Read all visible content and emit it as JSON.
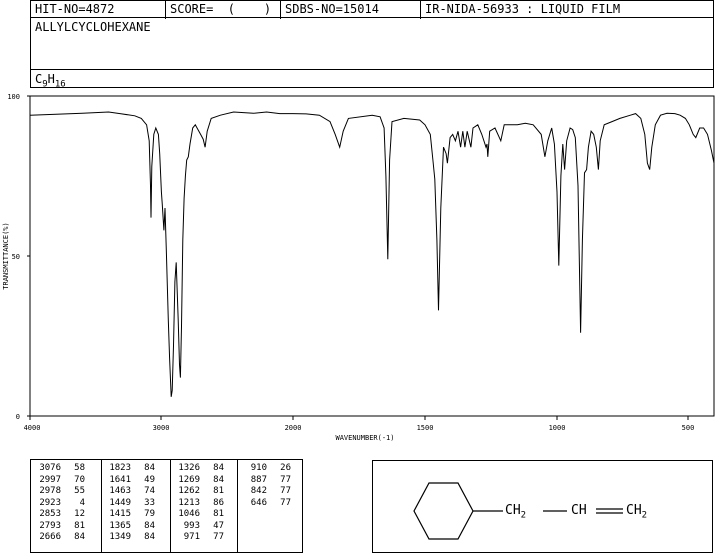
{
  "header": {
    "hit_no": "HIT-NO=4872",
    "score": "SCORE=  (    )",
    "sdbs_no": "SDBS-NO=15014",
    "method": "IR-NIDA-56933 : LIQUID FILM"
  },
  "compound": {
    "name": "ALLYLCYCLOHEXANE",
    "formula_c": "C",
    "formula_c_sub": "9",
    "formula_h": "H",
    "formula_h_sub": "16"
  },
  "chart_data": {
    "type": "line",
    "xlabel": "WAVENUMBER(-1)",
    "ylabel": "TRANSMITTANCE(%)",
    "xlim": [
      4000,
      400
    ],
    "ylim": [
      0,
      100
    ],
    "x_ticks": [
      4000,
      3000,
      2000,
      1500,
      1000,
      500
    ],
    "y_ticks": [
      100,
      50,
      0
    ],
    "x_tick_labels": [
      "4000",
      "3000",
      "2000",
      "1500",
      "1000",
      "500"
    ],
    "y_tick_labels": [
      "100",
      "50",
      "0"
    ],
    "series": [
      {
        "points": [
          [
            4000,
            94
          ],
          [
            3800,
            94.3
          ],
          [
            3600,
            94.6
          ],
          [
            3400,
            95
          ],
          [
            3300,
            94.4
          ],
          [
            3200,
            93.8
          ],
          [
            3150,
            93
          ],
          [
            3110,
            91
          ],
          [
            3090,
            86
          ],
          [
            3080,
            72
          ],
          [
            3076,
            62
          ],
          [
            3070,
            78
          ],
          [
            3055,
            88
          ],
          [
            3040,
            90
          ],
          [
            3020,
            88
          ],
          [
            3010,
            82
          ],
          [
            2997,
            70
          ],
          [
            2990,
            66
          ],
          [
            2978,
            58
          ],
          [
            2970,
            65
          ],
          [
            2960,
            52
          ],
          [
            2945,
            30
          ],
          [
            2935,
            18
          ],
          [
            2923,
            6
          ],
          [
            2915,
            8
          ],
          [
            2905,
            22
          ],
          [
            2895,
            42
          ],
          [
            2885,
            48
          ],
          [
            2870,
            30
          ],
          [
            2860,
            16
          ],
          [
            2853,
            12
          ],
          [
            2845,
            28
          ],
          [
            2835,
            55
          ],
          [
            2825,
            68
          ],
          [
            2815,
            75
          ],
          [
            2805,
            80
          ],
          [
            2793,
            81
          ],
          [
            2780,
            85
          ],
          [
            2760,
            90
          ],
          [
            2740,
            91
          ],
          [
            2700,
            88
          ],
          [
            2680,
            86.5
          ],
          [
            2666,
            84
          ],
          [
            2650,
            89
          ],
          [
            2620,
            93
          ],
          [
            2550,
            94
          ],
          [
            2450,
            95
          ],
          [
            2300,
            94.6
          ],
          [
            2200,
            95
          ],
          [
            2100,
            94.5
          ],
          [
            2000,
            94.5
          ],
          [
            1950,
            94.4
          ],
          [
            1900,
            94
          ],
          [
            1860,
            92
          ],
          [
            1840,
            88
          ],
          [
            1823,
            84
          ],
          [
            1810,
            89
          ],
          [
            1790,
            93
          ],
          [
            1700,
            94
          ],
          [
            1670,
            93.5
          ],
          [
            1655,
            90
          ],
          [
            1648,
            75
          ],
          [
            1641,
            49
          ],
          [
            1634,
            80
          ],
          [
            1625,
            92
          ],
          [
            1580,
            93
          ],
          [
            1520,
            92.5
          ],
          [
            1500,
            91
          ],
          [
            1480,
            88
          ],
          [
            1470,
            80
          ],
          [
            1463,
            74
          ],
          [
            1455,
            55
          ],
          [
            1449,
            33
          ],
          [
            1440,
            65
          ],
          [
            1430,
            84
          ],
          [
            1420,
            82
          ],
          [
            1415,
            79
          ],
          [
            1405,
            87
          ],
          [
            1395,
            88
          ],
          [
            1385,
            86
          ],
          [
            1375,
            89
          ],
          [
            1365,
            84
          ],
          [
            1357,
            89
          ],
          [
            1349,
            84
          ],
          [
            1340,
            89
          ],
          [
            1326,
            84
          ],
          [
            1318,
            90
          ],
          [
            1300,
            91
          ],
          [
            1285,
            88
          ],
          [
            1269,
            84
          ],
          [
            1265,
            85
          ],
          [
            1262,
            81
          ],
          [
            1255,
            89
          ],
          [
            1235,
            90
          ],
          [
            1213,
            86
          ],
          [
            1200,
            91
          ],
          [
            1150,
            91
          ],
          [
            1120,
            91.5
          ],
          [
            1090,
            91
          ],
          [
            1060,
            88
          ],
          [
            1046,
            81
          ],
          [
            1035,
            86
          ],
          [
            1020,
            90
          ],
          [
            1010,
            85
          ],
          [
            1000,
            70
          ],
          [
            993,
            47
          ],
          [
            985,
            75
          ],
          [
            978,
            85
          ],
          [
            971,
            77
          ],
          [
            963,
            86
          ],
          [
            950,
            90
          ],
          [
            940,
            89.5
          ],
          [
            930,
            87
          ],
          [
            920,
            72
          ],
          [
            910,
            26
          ],
          [
            903,
            55
          ],
          [
            895,
            76
          ],
          [
            887,
            77
          ],
          [
            880,
            84
          ],
          [
            870,
            89
          ],
          [
            860,
            88
          ],
          [
            850,
            84
          ],
          [
            842,
            77
          ],
          [
            835,
            86
          ],
          [
            820,
            91
          ],
          [
            790,
            92
          ],
          [
            760,
            93
          ],
          [
            720,
            94
          ],
          [
            700,
            94.5
          ],
          [
            680,
            93
          ],
          [
            665,
            88
          ],
          [
            655,
            79
          ],
          [
            646,
            77
          ],
          [
            638,
            84
          ],
          [
            625,
            91
          ],
          [
            605,
            94
          ],
          [
            580,
            94.6
          ],
          [
            550,
            94.5
          ],
          [
            530,
            94
          ],
          [
            510,
            93
          ],
          [
            495,
            91
          ],
          [
            480,
            88
          ],
          [
            470,
            87
          ],
          [
            455,
            90
          ],
          [
            440,
            90
          ],
          [
            425,
            88
          ],
          [
            410,
            83
          ],
          [
            400,
            79
          ]
        ]
      }
    ]
  },
  "peak_table": {
    "columns": [
      [
        [
          "3076",
          "58"
        ],
        [
          "2997",
          "70"
        ],
        [
          "2978",
          "55"
        ],
        [
          "2923",
          "4"
        ],
        [
          "2853",
          "12"
        ],
        [
          "2793",
          "81"
        ],
        [
          "2666",
          "84"
        ]
      ],
      [
        [
          "1823",
          "84"
        ],
        [
          "1641",
          "49"
        ],
        [
          "1463",
          "74"
        ],
        [
          "1449",
          "33"
        ],
        [
          "1415",
          "79"
        ],
        [
          "1365",
          "84"
        ],
        [
          "1349",
          "84"
        ]
      ],
      [
        [
          "1326",
          "84"
        ],
        [
          "1269",
          "84"
        ],
        [
          "1262",
          "81"
        ],
        [
          "1213",
          "86"
        ],
        [
          "1046",
          "81"
        ],
        [
          "993",
          "47"
        ],
        [
          "971",
          "77"
        ]
      ],
      [
        [
          "910",
          "26"
        ],
        [
          "887",
          "77"
        ],
        [
          "842",
          "77"
        ],
        [
          "646",
          "77"
        ]
      ]
    ]
  },
  "structure": {
    "ch2_a": "CH",
    "ch2_a_sub": "2",
    "ch": "CH",
    "ch2_b": "CH",
    "ch2_b_sub": "2"
  }
}
